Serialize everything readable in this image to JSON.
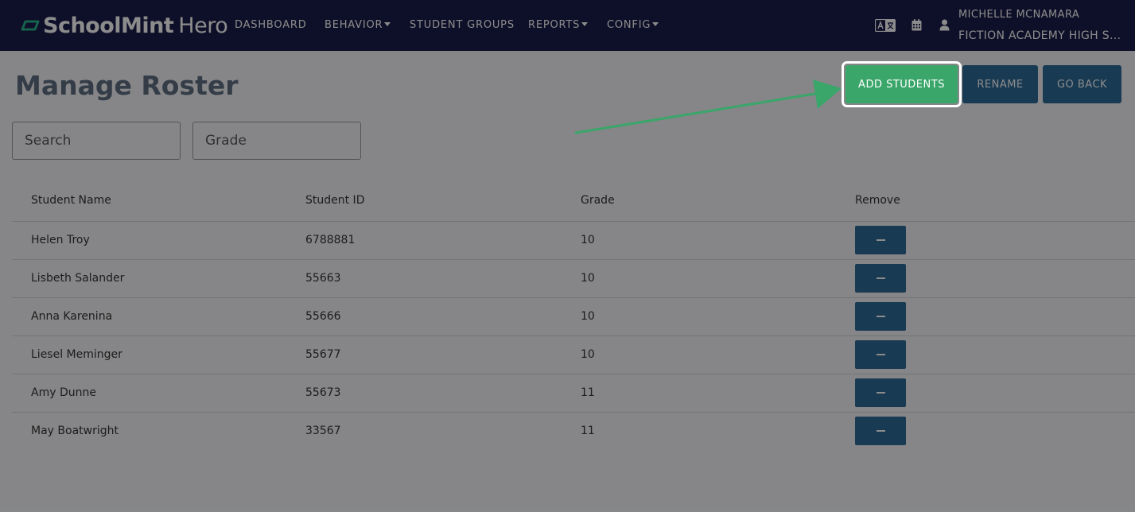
{
  "brand": {
    "name_bold": "SchoolMint",
    "name_light": "Hero",
    "accent": "#2bb38a"
  },
  "nav": [
    {
      "label": "DASHBOARD",
      "has_caret": false
    },
    {
      "label": "BEHAVIOR",
      "has_caret": true
    },
    {
      "label": "STUDENT GROUPS",
      "has_caret": false
    },
    {
      "label": "REPORTS",
      "has_caret": true
    },
    {
      "label": "CONFIG",
      "has_caret": true
    }
  ],
  "header_icons": [
    "language-translate-icon",
    "calendar-icon",
    "user-icon"
  ],
  "user": {
    "name": "MICHELLE MCNAMARA",
    "school": "FICTION ACADEMY HIGH S..."
  },
  "page": {
    "title": "Manage Roster"
  },
  "actions": {
    "add_students": "ADD STUDENTS",
    "rename": "RENAME",
    "go_back": "GO BACK"
  },
  "filters": {
    "search_placeholder": "Search",
    "grade_placeholder": "Grade"
  },
  "table": {
    "headers": [
      "Student Name",
      "Student ID",
      "Grade",
      "Remove"
    ],
    "rows": [
      {
        "name": "Helen Troy",
        "id": "6788881",
        "grade": "10"
      },
      {
        "name": "Lisbeth Salander",
        "id": "55663",
        "grade": "10"
      },
      {
        "name": "Anna Karenina",
        "id": "55666",
        "grade": "10"
      },
      {
        "name": "Liesel Meminger",
        "id": "55677",
        "grade": "10"
      },
      {
        "name": "Amy Dunne",
        "id": "55673",
        "grade": "11"
      },
      {
        "name": "May Boatwright",
        "id": "33567",
        "grade": "11"
      }
    ]
  },
  "colors": {
    "nav_bg": "#1a1c4a",
    "primary": "#2d6a97",
    "success": "#3aa66a",
    "arrow": "#3aa66a"
  }
}
